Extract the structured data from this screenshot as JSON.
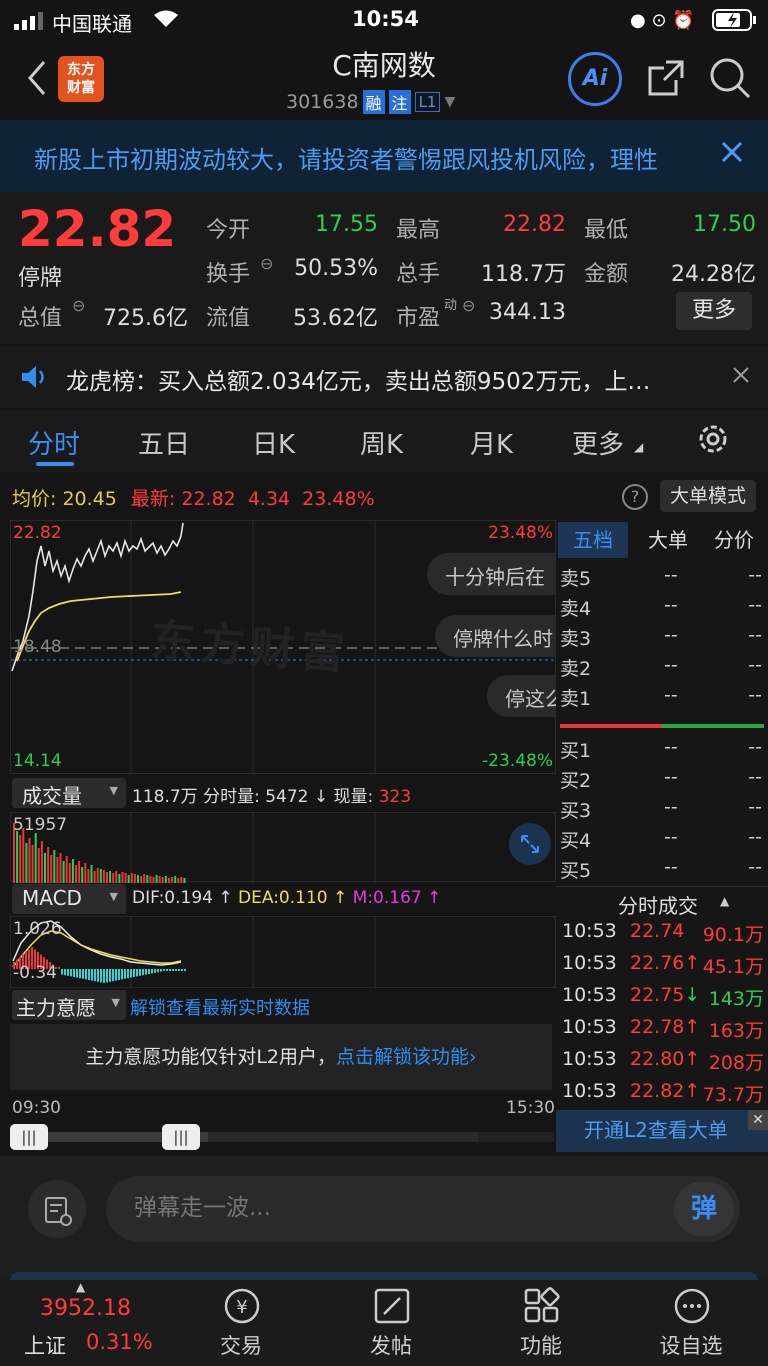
{
  "status": {
    "carrier": "中国联通",
    "time": "10:54"
  },
  "nav": {
    "title": "C南网数",
    "code": "301638",
    "badge1": "融",
    "badge2": "注",
    "badge3": "L1",
    "logo_line1": "东方",
    "logo_line2": "财富",
    "ai_label": "Ai"
  },
  "banner": {
    "text": "新股上市初期波动较大，请投资者警惕跟风投机风险，理性"
  },
  "quote": {
    "price": "22.82",
    "status": "停牌",
    "open_label": "今开",
    "open": "17.55",
    "high_label": "最高",
    "high": "22.82",
    "low_label": "最低",
    "low": "17.50",
    "turnover_label": "换手",
    "turnover": "50.53%",
    "vol_label": "总手",
    "vol": "118.7万",
    "amount_label": "金额",
    "amount": "24.28亿",
    "mcap_label": "总值",
    "mcap": "725.6亿",
    "float_label": "流值",
    "float": "53.62亿",
    "pe_label": "市盈",
    "pe_sup": "动",
    "pe": "344.13",
    "more": "更多"
  },
  "news": {
    "text": "龙虎榜：买入总额2.034亿元，卖出总额9502万元，上…"
  },
  "tabs": [
    "分时",
    "五日",
    "日K",
    "周K",
    "月K",
    "更多"
  ],
  "chart": {
    "avg_label": "均价:",
    "avg": "20.45",
    "latest_label": "最新:",
    "latest": "22.82",
    "chg": "4.34",
    "pct": "23.48%",
    "bigorder_mode": "大单模式",
    "y_top": "22.82",
    "y_mid": "18.48",
    "y_bot": "14.14",
    "pct_top": "23.48%",
    "pct_bot": "-23.48%",
    "watermark": "东方财富",
    "bubbles": [
      "十分钟后在",
      "停牌什么时",
      "停这么"
    ],
    "vol_sel": "成交量",
    "vol_total": "118.7万",
    "vol_now_label": "分时量:",
    "vol_now": "5472",
    "vol_cur_label": "现量:",
    "vol_cur": "323",
    "vol_max": "51957",
    "macd_sel": "MACD",
    "dif": "DIF:0.194",
    "dea": "DEA:0.110",
    "m": "M:0.167",
    "macd_top": "1.026",
    "macd_bot": "-0.34",
    "zl_sel": "主力意愿",
    "zl_unlock": "解锁查看最新实时数据",
    "zl_msg": "主力意愿功能仅针对L2用户，",
    "zl_link": "点击解锁该功能",
    "t_start": "09:30",
    "t_end": "15:30"
  },
  "orderbook": {
    "tabs": [
      "五档",
      "大单",
      "分价"
    ],
    "asks": [
      {
        "label": "卖5",
        "p": "--",
        "v": "--"
      },
      {
        "label": "卖4",
        "p": "--",
        "v": "--"
      },
      {
        "label": "卖3",
        "p": "--",
        "v": "--"
      },
      {
        "label": "卖2",
        "p": "--",
        "v": "--"
      },
      {
        "label": "卖1",
        "p": "--",
        "v": "--"
      }
    ],
    "bids": [
      {
        "label": "买1",
        "p": "--",
        "v": "--"
      },
      {
        "label": "买2",
        "p": "--",
        "v": "--"
      },
      {
        "label": "买3",
        "p": "--",
        "v": "--"
      },
      {
        "label": "买4",
        "p": "--",
        "v": "--"
      },
      {
        "label": "买5",
        "p": "--",
        "v": "--"
      }
    ],
    "ticks_title": "分时成交",
    "ticks": [
      {
        "t": "10:53",
        "p": "22.74",
        "v": "90.1万"
      },
      {
        "t": "10:53",
        "p": "22.76↑",
        "v": "45.1万"
      },
      {
        "t": "10:53",
        "p": "22.75↓",
        "v": "143万"
      },
      {
        "t": "10:53",
        "p": "22.78↑",
        "v": "163万"
      },
      {
        "t": "10:53",
        "p": "22.80↑",
        "v": "208万"
      },
      {
        "t": "10:53",
        "p": "22.82↑",
        "v": "73.7万"
      }
    ],
    "l2": "开通L2查看大单"
  },
  "comment": {
    "placeholder": "弹幕走一波...",
    "btn": "弹"
  },
  "bottom": {
    "index_val": "3952.18",
    "index_name": "上证",
    "index_pct": "0.31%",
    "items": [
      "交易",
      "发帖",
      "功能",
      "设自选"
    ]
  }
}
